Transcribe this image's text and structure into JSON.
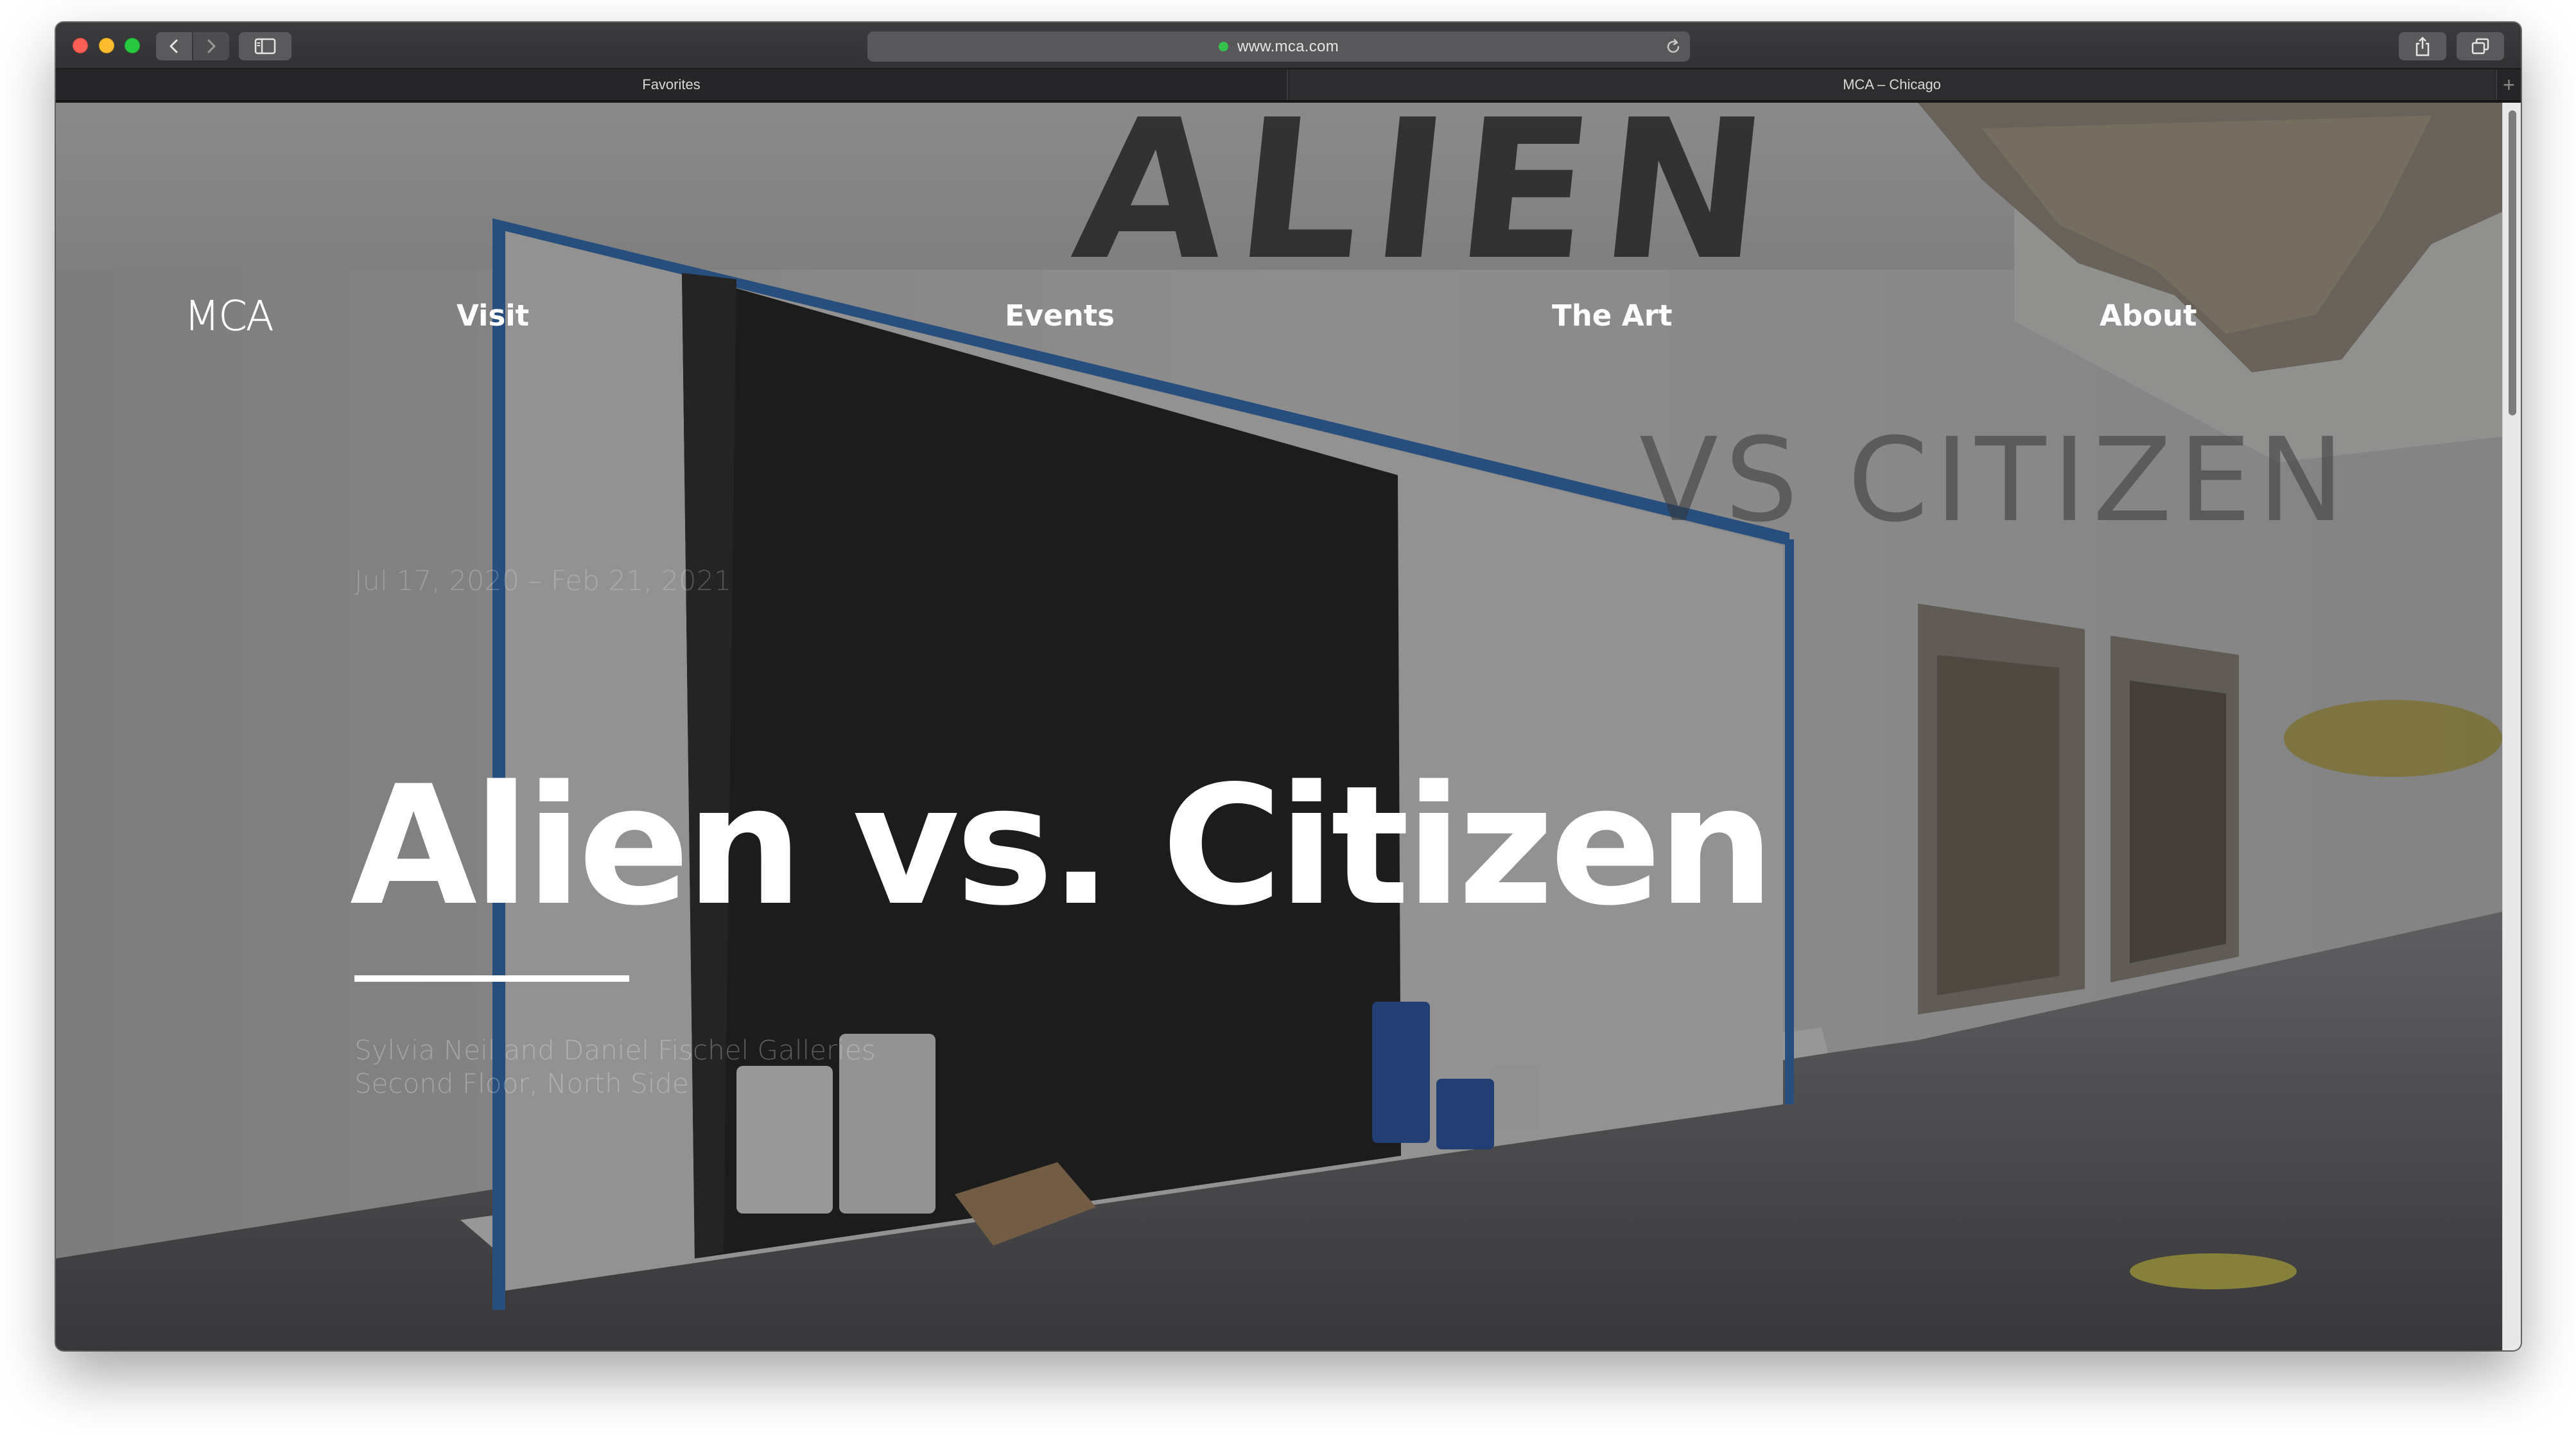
{
  "browser": {
    "url": "www.mca.com",
    "tabs": [
      {
        "label": "Favorites"
      },
      {
        "label": "MCA – Chicago"
      }
    ],
    "new_tab": "+"
  },
  "site": {
    "logo": "MCA",
    "nav": [
      {
        "label": "Visit"
      },
      {
        "label": "Events"
      },
      {
        "label": "The Art"
      },
      {
        "label": "About"
      }
    ]
  },
  "hero": {
    "dates": "Jul 17, 2020 – Feb 21, 2021",
    "title": "Alien vs. Citizen",
    "location_line1": "Sylvia Neil and Daniel Fischel Galleries",
    "location_line2": "Second Floor, North Side",
    "wall_text_top": "ALIEN",
    "wall_text_right": "VS CITIZEN"
  },
  "colors": {
    "close": "#fe5f57",
    "minimize": "#febc2e",
    "maximize": "#28c840",
    "secure": "#35c24c",
    "painter_tape": "#2f6fb8",
    "paint_black": "#1e1e1e"
  },
  "icons": {
    "back": "chevron-left-icon",
    "forward": "chevron-right-icon",
    "sidebar": "sidebar-icon",
    "reload": "reload-icon",
    "share": "share-icon",
    "tabs": "tabs-overview-icon"
  }
}
